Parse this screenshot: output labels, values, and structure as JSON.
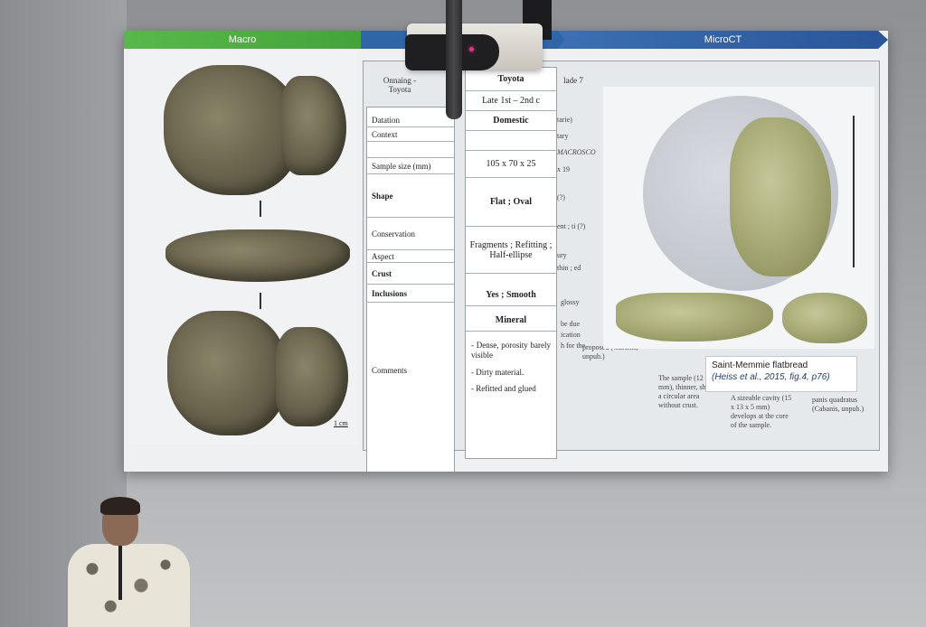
{
  "slide": {
    "banners": {
      "macro": "Macro",
      "microct": "MicroCT"
    },
    "scale_label": "1 cm",
    "table_background": {
      "hdr_1": "Onnaing - Toyota",
      "hdr_2": "lade 7",
      "cell_dated": "tarie)",
      "cell_tary": "tary",
      "cell_macrosco": "MACROSCO",
      "cell_19": "x 19",
      "cell_2": "(?)",
      "cell_ent": "ent ; ti (?)",
      "cell_ury": "ury",
      "cell_thin": "thin ; ed",
      "cell_glossy": "glossy",
      "cell_due": "be due",
      "cell_ication": "ication",
      "cell_for": "h for the",
      "cell_proposed": "proposed (Cabanis, unpub.)",
      "cell_sample": "The sample (12 17 mm), thinner, shows a circular area without crust.",
      "cell_cavity": "A sizeable cavity (15 x 13 x 5 mm) develops at the core of the sample.",
      "cell_panis": "panis quadratus (Cabanis, unpub.)"
    },
    "row_labels": [
      {
        "label": "Datation",
        "bold": false
      },
      {
        "label": "Context",
        "bold": false
      },
      {
        "label": "",
        "bold": false
      },
      {
        "label": "Sample size (mm)",
        "bold": false
      },
      {
        "label": "Shape",
        "bold": true
      },
      {
        "label": "Conservation",
        "bold": false
      },
      {
        "label": "Aspect",
        "bold": false
      },
      {
        "label": "Crust",
        "bold": true
      },
      {
        "label": "Inclusions",
        "bold": true
      },
      {
        "label": "Comments",
        "bold": false
      }
    ],
    "value_column": {
      "title": "Toyota",
      "rows": [
        {
          "value": "Late 1st – 2nd c",
          "bold": false
        },
        {
          "value": "Domestic",
          "bold": true
        },
        {
          "value": "",
          "bold": false
        },
        {
          "value": "105 x 70 x 25",
          "bold": false
        },
        {
          "value": "Flat ; Oval",
          "bold": true
        },
        {
          "value": "Fragments ; Refitting ; Half-ellipse",
          "bold": false
        },
        {
          "value": "Yes ; Smooth",
          "bold": true
        },
        {
          "value": "Mineral",
          "bold": true
        }
      ],
      "comments": [
        "- Dense, porosity barely visible",
        "- Dirty material.",
        "- Refitted and glued"
      ]
    },
    "caption": {
      "title": "Saint-Memmie flatbread",
      "citation": "(Heiss et al., 2015, fig.4, p76)"
    }
  }
}
